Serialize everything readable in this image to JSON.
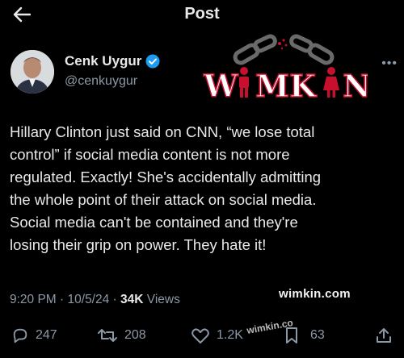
{
  "header": {
    "title": "Post"
  },
  "author": {
    "name": "Cenk Uygur",
    "handle": "@cenkuygur"
  },
  "logo": {
    "text_left": "W",
    "text_mid": "MK",
    "text_right": "N",
    "brand": "WIMKIN"
  },
  "post": {
    "lines": [
      "Hillary Clinton just said on CNN, “we lose total",
      "control” if social media content is not more",
      "regulated. Exactly! She's accidentally admitting",
      "the whole point of their attack on social media.",
      "Social media can't be contained and they're",
      "losing their grip on power. They hate it!"
    ]
  },
  "meta": {
    "time": "9:20 PM",
    "date": "10/5/24",
    "views_count": "34K",
    "views_label": "Views"
  },
  "watermark": {
    "primary": "wimkin.com",
    "secondary": "wimkin.co"
  },
  "actions": {
    "replies": "247",
    "reposts": "208",
    "likes": "1.2K",
    "bookmarks": "63"
  },
  "colors": {
    "background": "#000000",
    "text": "#e7e9ea",
    "muted": "#8b98a5",
    "verified": "#1d9bf0",
    "logo_red": "#c8102e"
  }
}
